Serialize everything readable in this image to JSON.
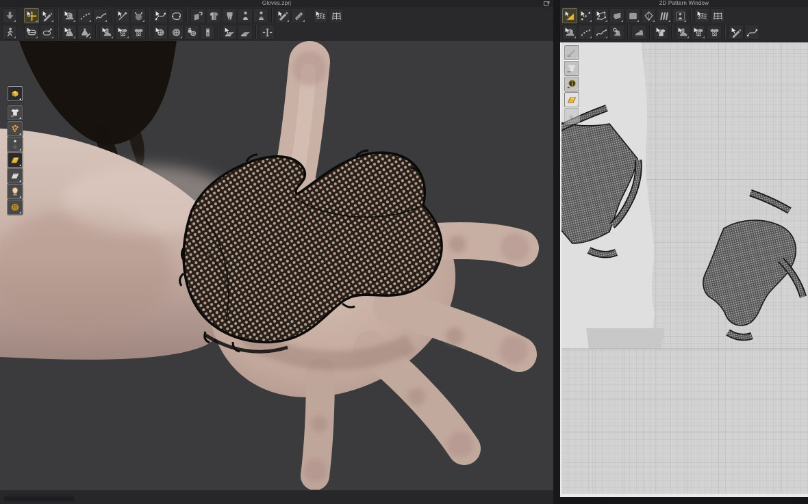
{
  "windows": {
    "w3d": {
      "title": "Gloves.zprj",
      "float_button": "float-window-button",
      "toolbar_row1": [
        {
          "name": "download-arrow-tool",
          "glyph": "arrowdown",
          "flyout": true
        },
        {
          "sep": true
        },
        {
          "name": "select-move-tool",
          "glyph": "crosshair",
          "cursor": true,
          "active": true,
          "flyout": true
        },
        {
          "name": "select-curve-tool",
          "glyph": "pen",
          "cursor": true,
          "flyout": true
        },
        {
          "sep": true
        },
        {
          "name": "segment-sewing-tool",
          "glyph": "machine",
          "cursor": true,
          "flyout": true
        },
        {
          "name": "free-sewing-tool",
          "glyph": "dots",
          "flyout": true
        },
        {
          "name": "mn-sewing-tool",
          "glyph": "wave",
          "flyout": true
        },
        {
          "sep": true
        },
        {
          "name": "pin-tool",
          "glyph": "needle",
          "cursor": true
        },
        {
          "name": "pin-ball-tool",
          "glyph": "sphere",
          "flyout": true
        },
        {
          "sep": true
        },
        {
          "name": "select-sewing-tool",
          "glyph": "curvepts",
          "cursor": true
        },
        {
          "name": "edit-sewing-tool",
          "glyph": "blob"
        },
        {
          "sep": true
        },
        {
          "name": "flip-pattern-tool",
          "glyph": "flip"
        },
        {
          "name": "front-back-display-tool",
          "glyph": "shirt2"
        },
        {
          "name": "pants-display-tool",
          "glyph": "pants"
        },
        {
          "name": "avatar-display-tool",
          "glyph": "person"
        },
        {
          "name": "avatar-dress-display-tool",
          "glyph": "person2"
        },
        {
          "sep": true
        },
        {
          "name": "cut-tool",
          "glyph": "blade",
          "cursor": true,
          "flyout": true
        },
        {
          "name": "measure-tool",
          "glyph": "ruler",
          "flyout": true
        },
        {
          "sep": true
        },
        {
          "name": "uv-grid-tool",
          "glyph": "grid",
          "cursor": true
        },
        {
          "name": "uv-map-tool",
          "glyph": "grid2"
        }
      ],
      "toolbar_row2": [
        {
          "name": "walk-avatar-tool",
          "glyph": "walker",
          "flyout": true
        },
        {
          "sep": true
        },
        {
          "name": "tape-measure-tool",
          "glyph": "tape",
          "cursor": true,
          "flyout": true
        },
        {
          "name": "pin-tape-tool",
          "glyph": "tapepin",
          "flyout": true
        },
        {
          "sep": true
        },
        {
          "name": "select-garment-tool",
          "glyph": "dress",
          "cursor": true,
          "flyout": true
        },
        {
          "name": "edit-garment-tool",
          "glyph": "dresspen",
          "flyout": true
        },
        {
          "sep": true
        },
        {
          "name": "shoe-tool",
          "glyph": "boot",
          "cursor": true,
          "flyout": true
        },
        {
          "name": "pattern-texture-tool",
          "glyph": "shirtcheck",
          "cursor": true,
          "flyout": true
        },
        {
          "name": "garment-texture-tool",
          "glyph": "shirtcheck"
        },
        {
          "sep": true
        },
        {
          "name": "button-tool",
          "glyph": "buttonsm",
          "cursor": true
        },
        {
          "name": "buttonhole-tool",
          "glyph": "button",
          "flyout": true
        },
        {
          "name": "lock-button-tool",
          "glyph": "lockbutton"
        },
        {
          "name": "zipper-tool",
          "glyph": "zipper"
        },
        {
          "sep": true
        },
        {
          "name": "select-plane-tool",
          "glyph": "plane",
          "cursor": true
        },
        {
          "name": "plane-tool",
          "glyph": "plane"
        },
        {
          "sep": true
        },
        {
          "name": "zipper-pull-tool",
          "glyph": "zippull"
        }
      ],
      "side_tools": [
        {
          "name": "show-3d-garment-toggle",
          "glyph": "box3d",
          "pressed": true,
          "flyout": true
        },
        {
          "name": "show-garment-toggle",
          "glyph": "eyeshirt",
          "flyout": true
        },
        {
          "name": "show-pins-toggle",
          "glyph": "pins",
          "flyout": true
        },
        {
          "name": "show-mannequin-toggle",
          "glyph": "mannequin",
          "flyout": true
        },
        {
          "name": "show-fabric-toggle",
          "glyph": "fabric",
          "pressed": true,
          "flyout": true
        },
        {
          "name": "show-fold-arrangement-toggle",
          "glyph": "fold",
          "flyout": true
        },
        {
          "name": "show-avatar-toggle",
          "glyph": "head",
          "flyout": true
        },
        {
          "name": "show-environment-toggle",
          "glyph": "globe",
          "flyout": true
        }
      ]
    },
    "w2d": {
      "title": "2D Pattern Window",
      "toolbar_row1": [
        {
          "name": "transform-pattern-tool",
          "glyph": "triangle",
          "cursor": true,
          "active": true
        },
        {
          "name": "edit-pattern-tool",
          "glyph": "dotsline",
          "cursor": true,
          "flyout": true
        },
        {
          "name": "edit-curvature-tool",
          "glyph": "polycur",
          "cursor": true,
          "flyout": true
        },
        {
          "name": "add-point-tool",
          "glyph": "poly",
          "flyout": true
        },
        {
          "name": "polygon-pattern-tool",
          "glyph": "rectpat",
          "flyout": true
        },
        {
          "name": "dart-tool",
          "glyph": "dart",
          "flyout": true
        },
        {
          "name": "pleats-tool",
          "glyph": "pleats",
          "flyout": true
        },
        {
          "name": "trace-avatar-tool",
          "glyph": "personpat",
          "flyout": true
        },
        {
          "sep": true
        },
        {
          "name": "uv-grid-tool-2d",
          "glyph": "grid",
          "cursor": true
        },
        {
          "name": "uv-map-tool-2d",
          "glyph": "grid2"
        }
      ],
      "toolbar_row2": [
        {
          "name": "segment-sewing-tool-2d",
          "glyph": "machine",
          "cursor": true,
          "flyout": true
        },
        {
          "name": "free-sewing-tool-2d",
          "glyph": "dots",
          "flyout": true
        },
        {
          "name": "mn-sewing-tool-2d",
          "glyph": "wave",
          "flyout": true
        },
        {
          "name": "edit-sewing-tool-2d",
          "glyph": "magmachine"
        },
        {
          "sep": true
        },
        {
          "name": "steam-iron-tool",
          "glyph": "iron"
        },
        {
          "sep": true
        },
        {
          "name": "select-pattern-3d-tool",
          "glyph": "shirtsel",
          "cursor": true
        },
        {
          "sep": true
        },
        {
          "name": "shoe-tool-2d",
          "glyph": "boot",
          "cursor": true,
          "flyout": true
        },
        {
          "name": "pattern-texture-tool-2d",
          "glyph": "shirtcheck",
          "cursor": true,
          "flyout": true
        },
        {
          "name": "garment-texture-tool-2d",
          "glyph": "shirtcheck"
        },
        {
          "sep": true
        },
        {
          "name": "pen-line-tool",
          "glyph": "pen",
          "cursor": true
        },
        {
          "name": "edit-curve-points-tool",
          "glyph": "curvepts"
        }
      ],
      "side_tools": [
        {
          "name": "show-sewing-toggle",
          "glyph": "eyepen",
          "flyout": true
        },
        {
          "name": "show-pattern-toggle",
          "glyph": "eyeshirt",
          "flyout": true
        },
        {
          "name": "show-info-toggle",
          "glyph": "info",
          "flyout": true
        },
        {
          "name": "show-fabric-toggle-2d",
          "glyph": "fabric",
          "pressed": true,
          "flyout": true
        },
        {
          "name": "pattern-lock-toggle",
          "glyph": "lockshirt",
          "disabled": true
        }
      ]
    }
  },
  "colors": {
    "accent_yellow": "#e9b43c",
    "viewport_bg": "#3b3b3d",
    "chrome_bg": "#29292b",
    "titlebar_bg": "#232325",
    "canvas_bg": "#d2d2d2",
    "silhouette": "#dfdfdf",
    "pattern_piece_fill": "#555555",
    "net_dark": "#262019",
    "skin": "#c7afa5"
  }
}
